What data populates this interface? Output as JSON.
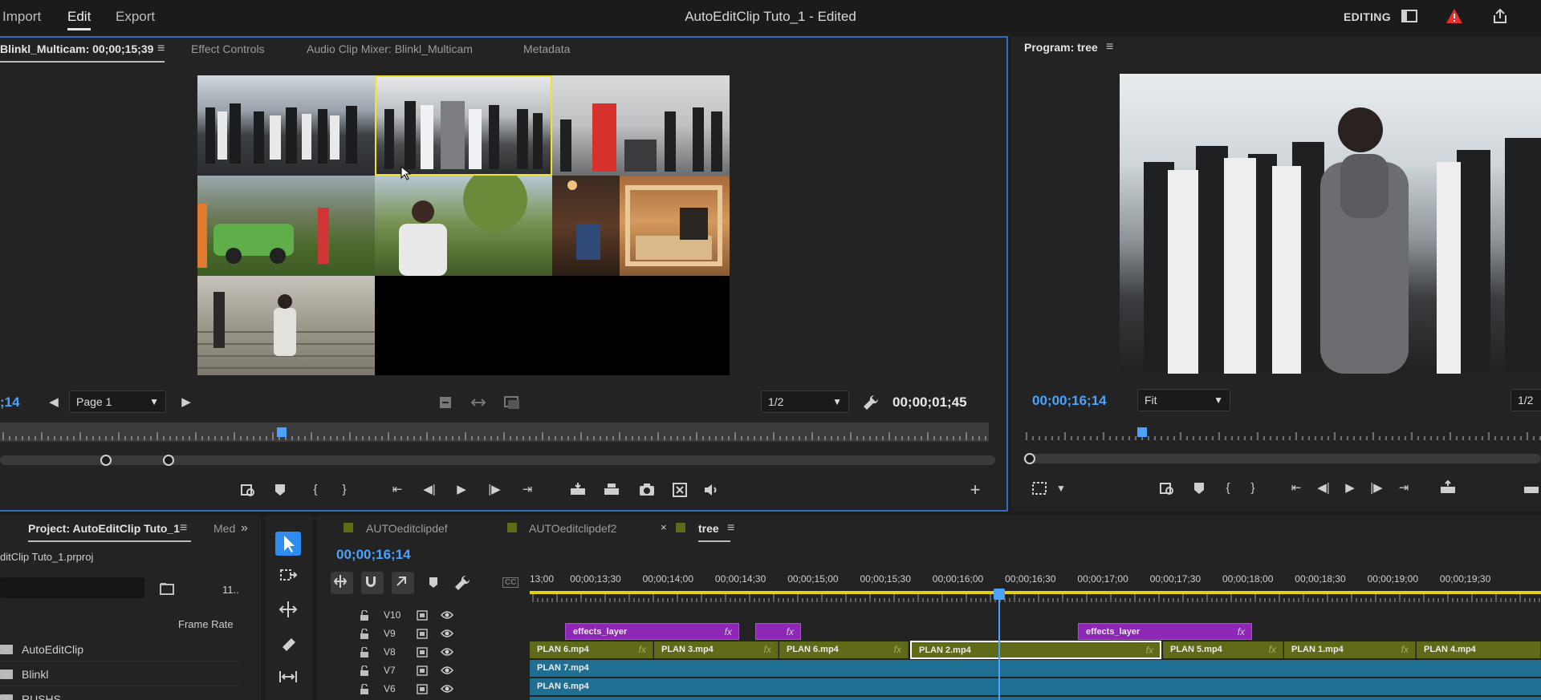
{
  "menu": {
    "import": "Import",
    "edit": "Edit",
    "export": "Export"
  },
  "app_title": "AutoEditClip Tuto_1 - Edited",
  "workspace": "EDITING",
  "source": {
    "tabs": [
      "Blinkl_Multicam: 00;00;15;39",
      "Effect Controls",
      "Audio Clip Mixer: Blinkl_Multicam",
      "Metadata"
    ],
    "timecode_left": ";14",
    "page_select": "Page 1",
    "resolution": "1/2",
    "duration": "00;00;01;45",
    "ruler_playhead_pct": 0.285
  },
  "program": {
    "tab": "Program: tree",
    "timecode": "00;00;16;14",
    "fit": "Fit",
    "resolution": "1/2",
    "ruler_playhead_pct": 0.23
  },
  "project": {
    "tab": "Project: AutoEditClip Tuto_1",
    "tab_extra": "Med",
    "file": "ditClip Tuto_1.prproj",
    "count": "11..",
    "col_framerate": "Frame Rate",
    "items": [
      "AutoEditClip",
      "Blinkl",
      "RUSHS"
    ]
  },
  "timeline": {
    "tabs": [
      "AUTOeditclipdef",
      "AUTOeditclipdef2",
      "tree"
    ],
    "close_mark": "×",
    "timecode": "00;00;16;14",
    "ruler_labels": [
      "13;00",
      "00;00;13;30",
      "00;00;14;00",
      "00;00;14;30",
      "00;00;15;00",
      "00;00;15;30",
      "00;00;16;00",
      "00;00;16;30",
      "00;00;17;00",
      "00;00;17;30",
      "00;00;18;00",
      "00;00;18;30",
      "00;00;19;00",
      "00;00;19;30"
    ],
    "cc": "CC",
    "tracks": [
      "V10",
      "V9",
      "V8",
      "V7",
      "V6"
    ],
    "v9_clips": [
      {
        "label": "effects_layer",
        "fx": "fx"
      },
      {
        "label": "",
        "fx": "fx"
      },
      {
        "label": "effects_layer",
        "fx": "fx"
      }
    ],
    "v8_clips": [
      {
        "label": "PLAN 6.mp4",
        "fx": "fx"
      },
      {
        "label": "PLAN 3.mp4",
        "fx": "fx"
      },
      {
        "label": "PLAN 6.mp4",
        "fx": "fx"
      },
      {
        "label": "PLAN 2.mp4",
        "fx": "fx"
      },
      {
        "label": "PLAN 5.mp4",
        "fx": "fx"
      },
      {
        "label": "PLAN 1.mp4",
        "fx": "fx"
      },
      {
        "label": "PLAN 4.mp4",
        "fx": ""
      }
    ],
    "v7_clip": "PLAN 7.mp4",
    "v6_clip": "PLAN 6.mp4"
  },
  "colors": {
    "accent": "#2d8cf0",
    "timecode": "#4aa3ff",
    "effect_clip": "#8e27b5",
    "video_clip": "#606a19",
    "selected_cam": "#f0e130"
  }
}
